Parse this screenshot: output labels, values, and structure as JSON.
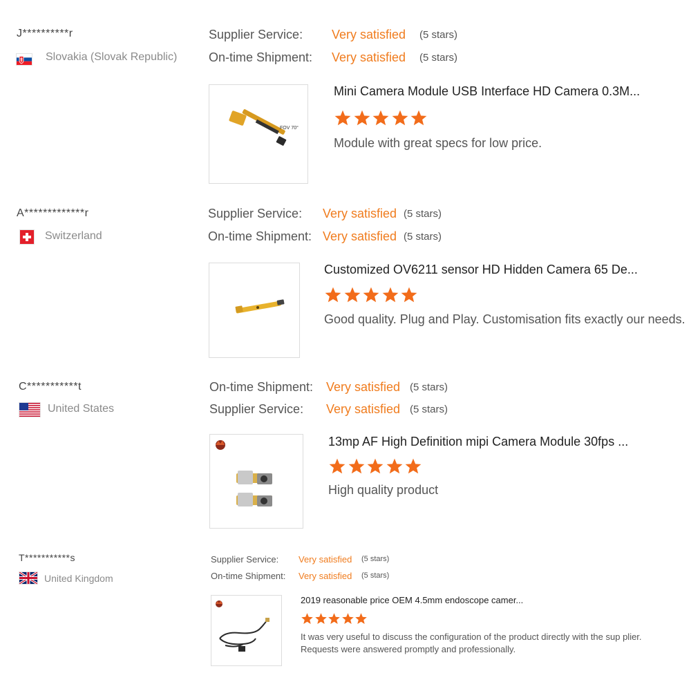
{
  "reviews": [
    {
      "user": "J**********r",
      "country": "Slovakia (Slovak Republic)",
      "flag": "slovakia-flag",
      "ratings": [
        {
          "label": "Supplier Service:",
          "value": "Very satisfied",
          "count": "(5 stars)"
        },
        {
          "label": "On-time Shipment:",
          "value": "Very satisfied",
          "count": "(5 stars)"
        }
      ],
      "product_title": "Mini Camera Module USB Interface HD Camera 0.3M...",
      "product_image_text": "FOV 70°",
      "stars": 5,
      "comment": "Module with great specs for low price."
    },
    {
      "user": "A*************r",
      "country": "Switzerland",
      "flag": "switzerland-flag",
      "ratings": [
        {
          "label": "Supplier Service:",
          "value": "Very satisfied",
          "count": "(5 stars)"
        },
        {
          "label": "On-time Shipment:",
          "value": "Very satisfied",
          "count": "(5 stars)"
        }
      ],
      "product_title": "Customized OV6211 sensor HD Hidden Camera 65 De...",
      "stars": 5,
      "comment": "Good quality. Plug and Play. Customisation fits exactly our needs."
    },
    {
      "user": "C***********t",
      "country": "United States",
      "flag": "united-states-flag",
      "ratings": [
        {
          "label": "On-time Shipment:",
          "value": "Very satisfied",
          "count": "(5 stars)"
        },
        {
          "label": "Supplier Service:",
          "value": "Very satisfied",
          "count": "(5 stars)"
        }
      ],
      "product_title": "13mp AF High Definition mipi Camera Module 30fps ...",
      "stars": 5,
      "comment": "High quality product"
    },
    {
      "user": "T***********s",
      "country": "United Kingdom",
      "flag": "united-kingdom-flag",
      "ratings": [
        {
          "label": "Supplier Service:",
          "value": "Very satisfied",
          "count": "(5 stars)"
        },
        {
          "label": "On-time Shipment:",
          "value": "Very satisfied",
          "count": "(5 stars)"
        }
      ],
      "product_title": "2019 reasonable price OEM 4.5mm endoscope camer...",
      "stars": 5,
      "comment": "It was very useful to discuss the configuration of the product directly with the sup plier. Requests were answered promptly and professionally."
    }
  ],
  "colors": {
    "accent_orange": "#f07c1e",
    "star_orange": "#f26c1a",
    "text_gray": "#8a8a8a"
  }
}
